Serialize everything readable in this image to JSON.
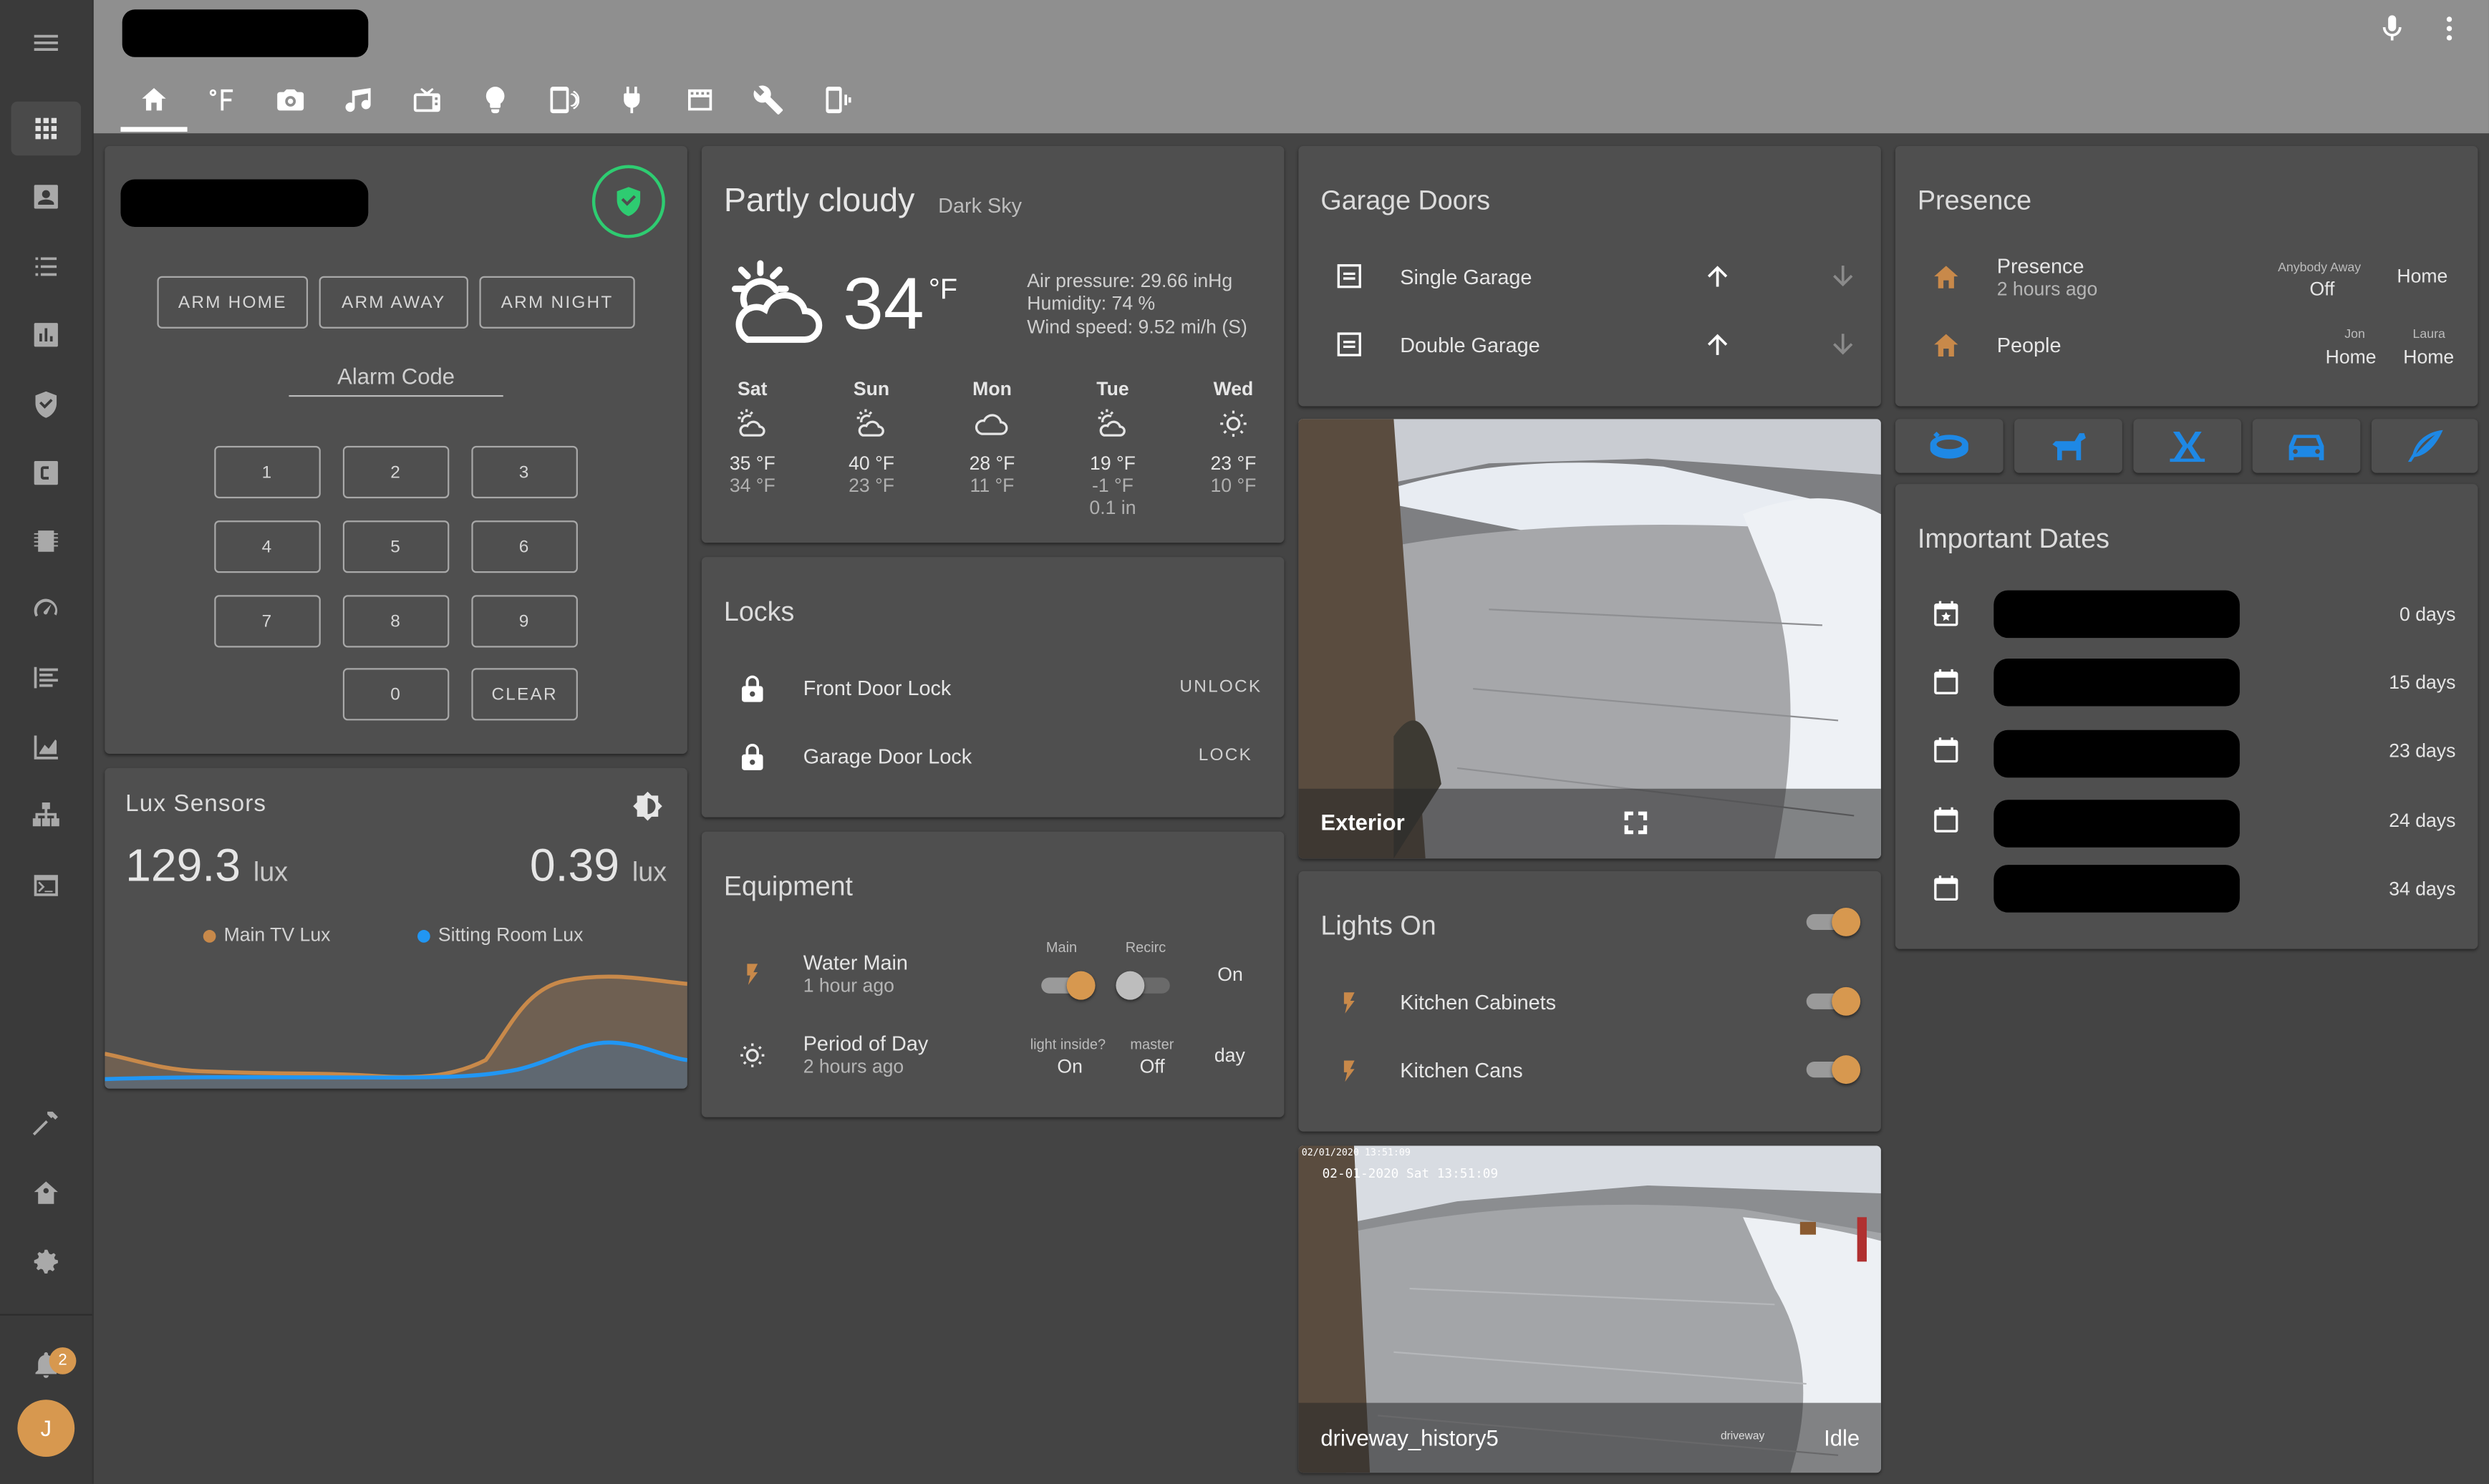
{
  "header": {
    "tabs": [
      "home",
      "thermometer-f",
      "camera",
      "music",
      "tv",
      "lightbulb",
      "cellphone-wireless",
      "power-plug",
      "film",
      "wrench",
      "phone-vibrate"
    ],
    "mic_icon": "microphone-icon",
    "menu_icon": "dots-vertical-icon"
  },
  "sidebar": {
    "items": [
      "view-dashboard",
      "account-box",
      "format-list-bulleted",
      "poll-box",
      "shield-check",
      "alpha-c-box",
      "chip",
      "speedometer",
      "format-list-text",
      "chart-areaspline",
      "sitemap",
      "console"
    ],
    "bottom_items": [
      "hammer",
      "home-assistant",
      "cog"
    ],
    "notification_count": "2",
    "avatar_initial": "J"
  },
  "alarm": {
    "buttons": [
      "ARM HOME",
      "ARM AWAY",
      "ARM NIGHT"
    ],
    "code_label": "Alarm Code",
    "keys": [
      "1",
      "2",
      "3",
      "4",
      "5",
      "6",
      "7",
      "8",
      "9",
      "0",
      "CLEAR"
    ],
    "status_color": "#2ecc71"
  },
  "weather": {
    "condition": "Partly cloudy",
    "source": "Dark Sky",
    "temp": "34",
    "unit": "°F",
    "pressure": "Air pressure: 29.66 inHg",
    "humidity": "Humidity: 74 %",
    "wind": "Wind speed: 9.52 mi/h (S)",
    "forecast": [
      {
        "day": "Sat",
        "high": "35 °F",
        "low": "34 °F",
        "precip": "",
        "icon": "partly-cloudy"
      },
      {
        "day": "Sun",
        "high": "40 °F",
        "low": "23 °F",
        "precip": "",
        "icon": "partly-cloudy"
      },
      {
        "day": "Mon",
        "high": "28 °F",
        "low": "11 °F",
        "precip": "",
        "icon": "cloudy"
      },
      {
        "day": "Tue",
        "high": "19 °F",
        "low": "-1 °F",
        "precip": "0.1 in",
        "icon": "partly-cloudy"
      },
      {
        "day": "Wed",
        "high": "23 °F",
        "low": "10 °F",
        "precip": "",
        "icon": "sunny"
      }
    ]
  },
  "lux": {
    "title": "Lux Sensors",
    "value1": "129.3",
    "value2": "0.39",
    "unit": "lux",
    "legend1": "Main TV Lux",
    "legend2": "Sitting Room Lux",
    "color1": "#c8894a",
    "color2": "#2196f3"
  },
  "locks": {
    "title": "Locks",
    "items": [
      {
        "name": "Front Door Lock",
        "action": "UNLOCK"
      },
      {
        "name": "Garage Door Lock",
        "action": "LOCK"
      }
    ]
  },
  "equipment": {
    "title": "Equipment",
    "water_name": "Water Main",
    "water_time": "1 hour ago",
    "main_label": "Main",
    "recirc_label": "Recirc",
    "water_state": "On",
    "period_name": "Period of Day",
    "period_time": "2 hours ago",
    "light_inside_label": "light inside?",
    "light_inside_value": "On",
    "master_label": "master",
    "master_value": "Off",
    "period_state": "day"
  },
  "garage": {
    "title": "Garage Doors",
    "items": [
      "Single Garage",
      "Double Garage"
    ]
  },
  "camera1": {
    "label": "Exterior"
  },
  "lights": {
    "title": "Lights On",
    "items": [
      "Kitchen Cabinets",
      "Kitchen Cans"
    ]
  },
  "camera2": {
    "label": "driveway_history5",
    "state": "Idle",
    "overlay_time": "02-01-2020 Sat 13:51:09",
    "overlay_small": "02/01/2020 13:51:09",
    "watermark": "driveway"
  },
  "presence": {
    "title": "Presence",
    "row1_name": "Presence",
    "row1_time": "2 hours ago",
    "row1_attr_label": "Anybody Away",
    "row1_attr_value": "Off",
    "row1_state": "Home",
    "row2_name": "People",
    "row2_attr1_label": "Jon",
    "row2_attr1_value": "Home",
    "row2_attr2_label": "Laura",
    "row2_attr2_value": "Home"
  },
  "quick_buttons": [
    "robot-vacuum",
    "dog-service",
    "robot-mower",
    "car",
    "feather"
  ],
  "dates": {
    "title": "Important Dates",
    "items": [
      "0 days",
      "15 days",
      "23 days",
      "24 days",
      "34 days"
    ]
  }
}
